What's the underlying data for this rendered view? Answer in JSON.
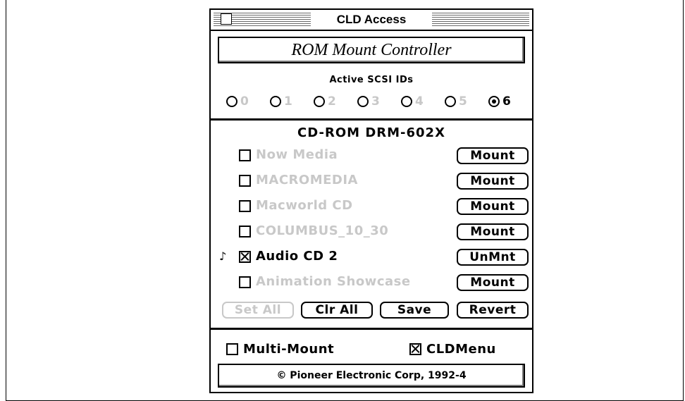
{
  "window": {
    "title": "CLD Access"
  },
  "header": {
    "label": "ROM Mount Controller"
  },
  "scsi": {
    "label": "Active SCSI IDs",
    "ids": [
      "0",
      "1",
      "2",
      "3",
      "4",
      "5",
      "6"
    ],
    "selected": "6"
  },
  "device": {
    "name": "CD-ROM DRM-602X",
    "volumes": [
      {
        "name": "Now Media",
        "checked": false,
        "button": "Mount",
        "active": false,
        "marker": ""
      },
      {
        "name": "MACROMEDIA",
        "checked": false,
        "button": "Mount",
        "active": false,
        "marker": ""
      },
      {
        "name": "Macworld CD",
        "checked": false,
        "button": "Mount",
        "active": false,
        "marker": ""
      },
      {
        "name": "COLUMBUS_10_30",
        "checked": false,
        "button": "Mount",
        "active": false,
        "marker": ""
      },
      {
        "name": "Audio CD 2",
        "checked": true,
        "button": "UnMnt",
        "active": true,
        "marker": "♪"
      },
      {
        "name": "Animation Showcase",
        "checked": false,
        "button": "Mount",
        "active": false,
        "marker": ""
      }
    ]
  },
  "actions": {
    "set_all": "Set All",
    "clr_all": "Clr All",
    "save": "Save",
    "revert": "Revert"
  },
  "options": {
    "multi_mount": {
      "label": "Multi-Mount",
      "checked": false
    },
    "cld_menu": {
      "label": "CLDMenu",
      "checked": true
    }
  },
  "footer": {
    "label": "© Pioneer Electronic Corp, 1992-4"
  }
}
